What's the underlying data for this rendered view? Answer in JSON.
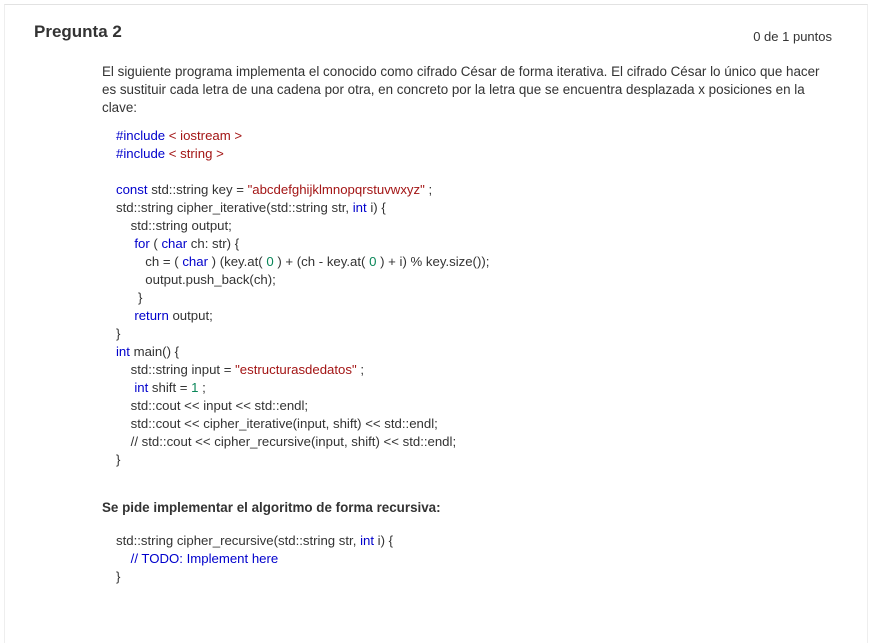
{
  "question": {
    "title": "Pregunta 2",
    "points": "0 de 1 puntos",
    "intro": "El siguiente programa implementa el conocido como cifrado César de forma iterativa. El cifrado César lo único que hacer es sustituir cada letra de una cadena por otra, en concreto por la letra que se encuentra desplazada x posiciones en la clave:",
    "subtitle": "Se pide implementar el algoritmo de forma recursiva:"
  },
  "code": {
    "include1_kw": "#include",
    "include1_lib": "< iostream >",
    "include2_kw": "#include",
    "include2_lib": "< string >",
    "key_const": "const",
    "key_decl": " std::string key = ",
    "key_value": "\"abcdefghijklmnopqrstuvwxyz\"",
    "key_end": " ;",
    "fn_sig_a": "std::string cipher_iterative(std::string str, ",
    "fn_sig_int": "int",
    "fn_sig_b": " i) {",
    "output_decl": "    std::string output;",
    "for_pre": "     ",
    "for_kw": "for",
    "for_paren": " ( ",
    "for_char": "char",
    "for_rest": " ch: str) {",
    "ch_a": "        ch = ( ",
    "ch_char": "char",
    "ch_b": " ) (key.at( ",
    "ch_zero1": "0",
    "ch_c": " ) + (ch - key.at( ",
    "ch_zero2": "0",
    "ch_d": " ) + i) % key.size());",
    "push_back": "        output.push_back(ch);",
    "close_for": "      }",
    "return_pre": "     ",
    "return_kw": "return",
    "return_rest": " output;",
    "close_fn": "}",
    "main_int": "int",
    "main_rest": " main() {",
    "input_a": "    std::string input = ",
    "input_str": "\"estructurasdedatos\"",
    "input_end": " ;",
    "shift_pre": "     ",
    "shift_int": "int",
    "shift_a": " shift = ",
    "shift_val": "1",
    "shift_end": " ;",
    "cout1": "    std::cout << input << std::endl;",
    "cout2": "    std::cout << cipher_iterative(input, shift) << std::endl;",
    "cout3": "    // std::cout << cipher_recursive(input, shift) << std::endl;",
    "close_main": "}"
  },
  "code2": {
    "sig_a": "std::string cipher_recursive(std::string str, ",
    "sig_int": "int",
    "sig_b": " i) {",
    "todo": "// TODO: Implement here",
    "todo_pre": "    ",
    "close": "}"
  }
}
